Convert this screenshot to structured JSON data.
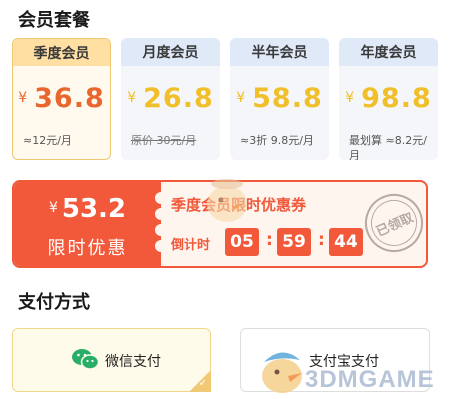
{
  "sections": {
    "membership_title": "会员套餐",
    "payment_title": "支付方式"
  },
  "plans": [
    {
      "name": "季度会员",
      "currency": "¥",
      "price": "36.8",
      "note": "≈12元/月",
      "selected": true
    },
    {
      "name": "月度会员",
      "currency": "¥",
      "price": "26.8",
      "note_strike": "原价 30元/月"
    },
    {
      "name": "半年会员",
      "currency": "¥",
      "price": "58.8",
      "note": "≈3折 9.8元/月"
    },
    {
      "name": "年度会员",
      "currency": "¥",
      "price": "98.8",
      "note": "最划算 ≈8.2元/月"
    }
  ],
  "promo": {
    "currency": "¥",
    "amount": "53.2",
    "label": "限时优惠",
    "coupon_title": "季度会员限时优惠券",
    "countdown_label": "倒计时",
    "hours": "05",
    "minutes": "59",
    "seconds": "44",
    "stamp": "已领取"
  },
  "payment": {
    "wechat_label": "微信支付",
    "alipay_label": "支付宝支付"
  },
  "watermark": "3DMGAME",
  "colors": {
    "accent_orange": "#f2583a",
    "price_gold": "#f0bf2a",
    "selected_border": "#f1c873",
    "wechat_green": "#2aae67"
  }
}
